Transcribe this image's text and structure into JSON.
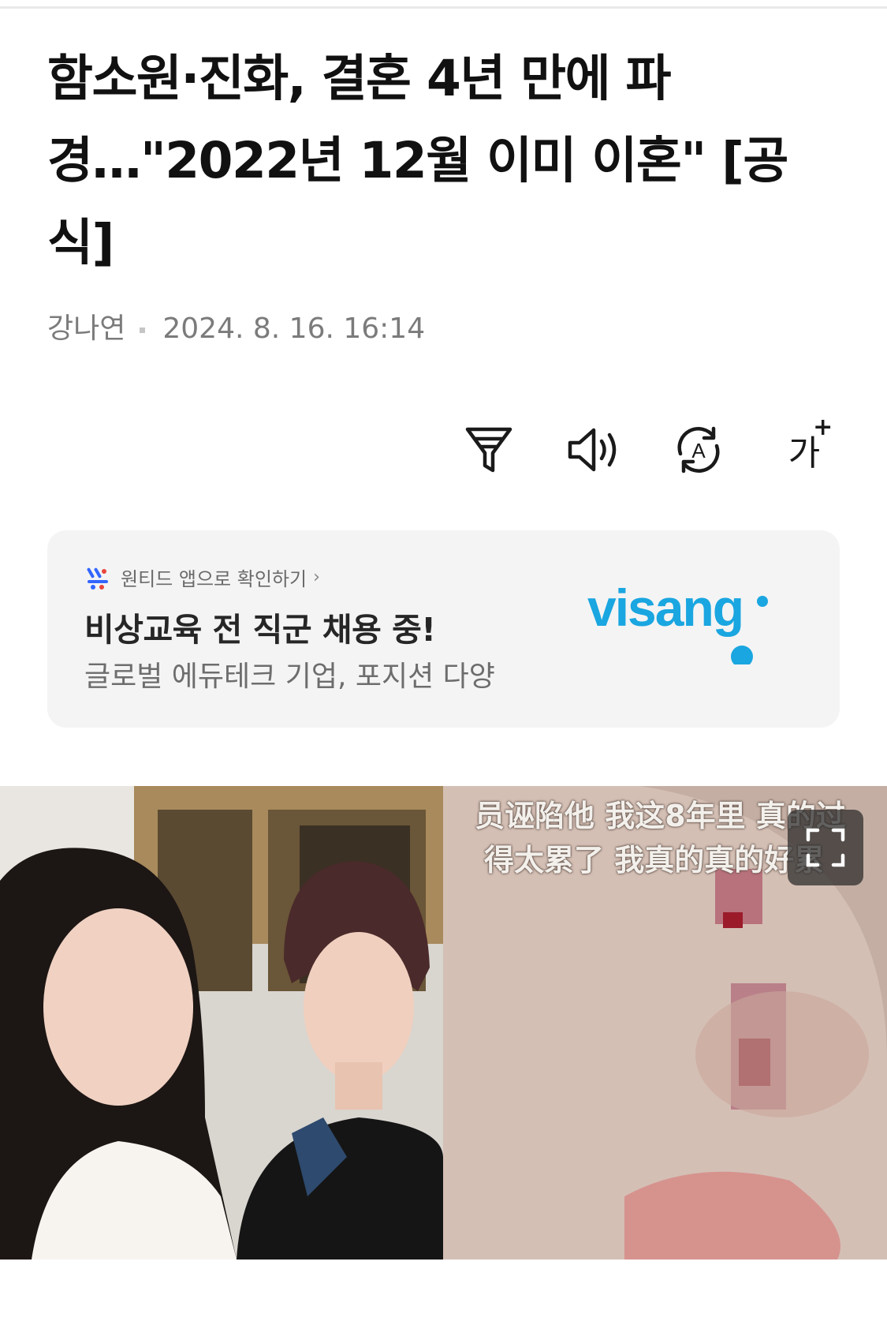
{
  "article": {
    "headline": "함소원·진화, 결혼 4년 만에 파경…\"2022년 12월 이미 이혼\" [공식]",
    "author": "강나연",
    "timestamp": "2024. 8. 16. 16:14"
  },
  "toolbar": {
    "tools": [
      {
        "name": "summary-filter-icon"
      },
      {
        "name": "speaker-icon"
      },
      {
        "name": "translate-icon",
        "letter": "A"
      },
      {
        "name": "font-size-icon",
        "label": "가",
        "plus": "+"
      }
    ]
  },
  "ad": {
    "source_label": "원티드 앱으로 확인하기",
    "source_chevron": "›",
    "title": "비상교육 전 직군 채용 중!",
    "description": "글로벌 에듀테크 기업, 포지션 다양",
    "brand": "visang",
    "brand_color": "#1aa6e0"
  },
  "photo": {
    "caption_lines": [
      "员诬陷他 我这8年里 真的过",
      "得太累了 我真的真的好累"
    ]
  }
}
